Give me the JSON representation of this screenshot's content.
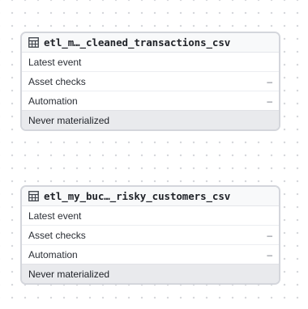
{
  "assets": [
    {
      "name": "etl_m…_cleaned_transactions_csv",
      "rows": [
        {
          "label": "Latest event",
          "value": ""
        },
        {
          "label": "Asset checks",
          "value": "–"
        },
        {
          "label": "Automation",
          "value": "–"
        }
      ],
      "status": "Never materialized",
      "icon": "table-icon"
    },
    {
      "name": "etl_my_buc…_risky_customers_csv",
      "rows": [
        {
          "label": "Latest event",
          "value": ""
        },
        {
          "label": "Asset checks",
          "value": "–"
        },
        {
          "label": "Automation",
          "value": "–"
        }
      ],
      "status": "Never materialized",
      "icon": "table-icon"
    }
  ]
}
